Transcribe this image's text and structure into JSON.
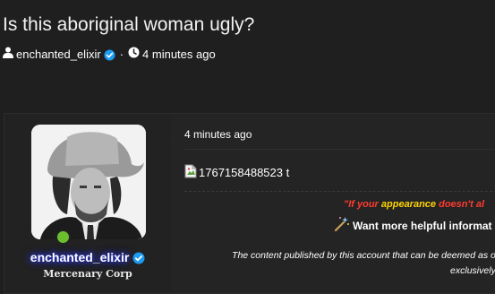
{
  "thread": {
    "title": "Is this aboriginal woman ugly?",
    "author": "enchanted_elixir",
    "separator": "·",
    "time": "4 minutes ago"
  },
  "post": {
    "user": {
      "name": "enchanted_elixir",
      "title": "Mercenary Corp",
      "online": true
    },
    "date": "4 minutes ago",
    "image_alt": "1767158488523 t",
    "quote": {
      "part1": "\"If your ",
      "part2": "appearance",
      "part3": " doesn't al"
    },
    "help_text": "Want more helpful informat",
    "disclaimer_line1": "The content published by this account that can be deemed as offer",
    "disclaimer_line2": "exclusively for"
  },
  "colors": {
    "background": "#1f1f1f",
    "verified": "#1d9bf0",
    "quote_red": "#ff3b2f",
    "quote_yellow": "#ffd400",
    "online": "#6bbf2f",
    "username_glow": "#2b3bff"
  },
  "icons": {
    "user": "user-icon",
    "verified": "verified-badge-icon",
    "clock": "clock-icon",
    "broken_image": "broken-image-icon",
    "wand": "magic-wand-icon"
  }
}
